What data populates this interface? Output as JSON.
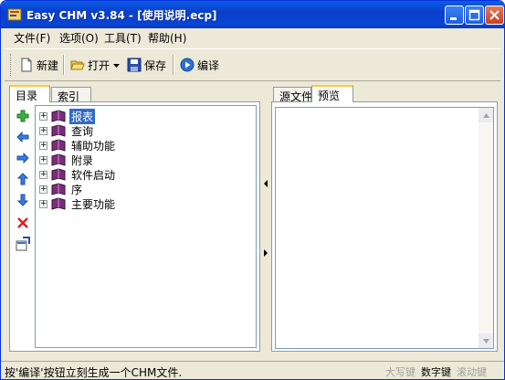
{
  "window": {
    "title": "Easy CHM v3.84 - [使用说明.ecp]"
  },
  "menu": [
    {
      "label": "文件(F)"
    },
    {
      "label": "选项(O)"
    },
    {
      "label": "工具(T)"
    },
    {
      "label": "帮助(H)"
    }
  ],
  "toolbar": {
    "new_label": "新建",
    "open_label": "打开",
    "save_label": "保存",
    "compile_label": "编译"
  },
  "left_tabs": {
    "toc": "目录",
    "index": "索引"
  },
  "right_tabs": {
    "source": "源文件",
    "preview": "预览"
  },
  "tree": [
    {
      "label": "报表",
      "selected": true
    },
    {
      "label": "查询"
    },
    {
      "label": "辅助功能"
    },
    {
      "label": "附录"
    },
    {
      "label": "软件启动"
    },
    {
      "label": "序"
    },
    {
      "label": "主要功能"
    }
  ],
  "status": {
    "message": "按'编译'按钮立刻生成一个CHM文件.",
    "caps": "大写键",
    "num": "数字键",
    "scroll": "滚动键"
  },
  "colors": {
    "selection": "#316AC5",
    "titlebar": "#0A3FC9",
    "book": "#7A2E7A"
  }
}
